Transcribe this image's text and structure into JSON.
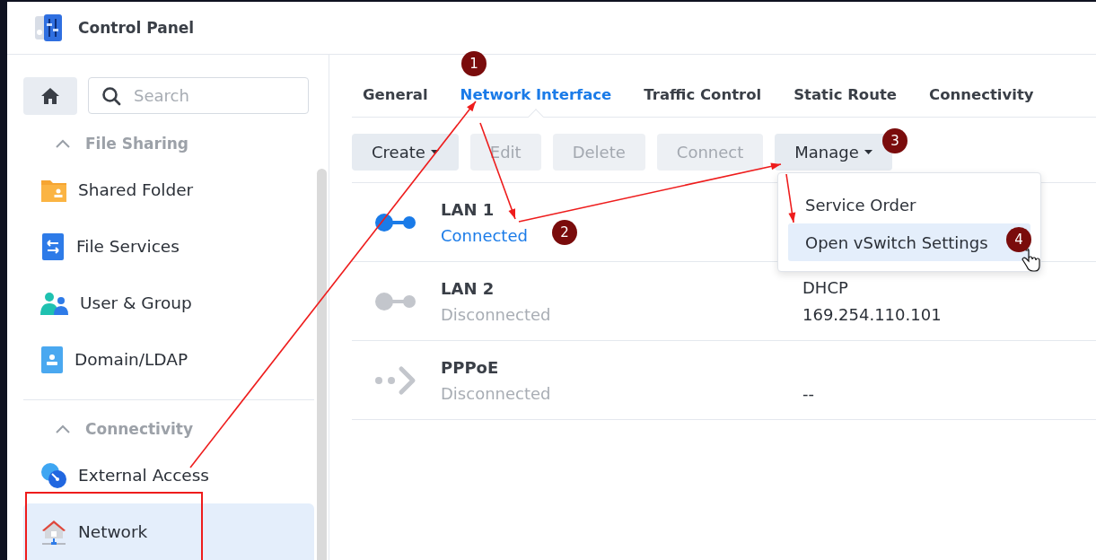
{
  "window": {
    "title": "Control Panel"
  },
  "sidebar": {
    "search": {
      "placeholder": "Search"
    },
    "sections": [
      {
        "title": "File Sharing",
        "expanded": true,
        "items": [
          {
            "label": "Shared Folder",
            "kind": "folder",
            "selected": false
          },
          {
            "label": "File Services",
            "kind": "file-services",
            "selected": false
          },
          {
            "label": "User & Group",
            "kind": "users",
            "selected": false
          },
          {
            "label": "Domain/LDAP",
            "kind": "domain",
            "selected": false
          }
        ]
      },
      {
        "title": "Connectivity",
        "expanded": true,
        "items": [
          {
            "label": "External Access",
            "kind": "external",
            "selected": false
          },
          {
            "label": "Network",
            "kind": "network",
            "selected": true
          }
        ]
      }
    ]
  },
  "tabs": [
    {
      "label": "General",
      "selected": false
    },
    {
      "label": "Network Interface",
      "selected": true
    },
    {
      "label": "Traffic Control",
      "selected": false
    },
    {
      "label": "Static Route",
      "selected": false
    },
    {
      "label": "Connectivity",
      "selected": false
    }
  ],
  "toolbar": [
    {
      "label": "Create",
      "disabled": false,
      "dropdown": true
    },
    {
      "label": "Edit",
      "disabled": true,
      "dropdown": false
    },
    {
      "label": "Delete",
      "disabled": true,
      "dropdown": false
    },
    {
      "label": "Connect",
      "disabled": true,
      "dropdown": false
    },
    {
      "label": "Manage",
      "disabled": false,
      "dropdown": true
    }
  ],
  "interfaces": [
    {
      "name": "LAN 1",
      "status": "Connected",
      "connected": true,
      "kind": "ethernet"
    },
    {
      "name": "LAN 2",
      "status": "Disconnected",
      "connected": false,
      "kind": "ethernet",
      "column_2": {
        "line_1": "DHCP",
        "line_2": "169.254.110.101"
      }
    },
    {
      "name": "PPPoE",
      "status": "Disconnected",
      "connected": false,
      "kind": "pppoe",
      "column_2": {
        "line_2": "--"
      }
    }
  ],
  "menu": {
    "items": [
      {
        "label": "Service Order",
        "selected": false
      },
      {
        "label": "Open vSwitch Settings",
        "selected": true
      }
    ]
  },
  "annotations": {
    "steps": [
      "1",
      "2",
      "3",
      "4"
    ]
  }
}
